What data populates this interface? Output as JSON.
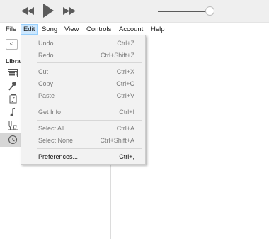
{
  "menubar": {
    "file": "File",
    "edit": "Edit",
    "song": "Song",
    "view": "View",
    "controls": "Controls",
    "account": "Account",
    "help": "Help"
  },
  "sidebar": {
    "back_glyph": "<",
    "library_header": "Libra",
    "icons": [
      "recently-added-icon",
      "artists-icon",
      "albums-icon",
      "songs-icon",
      "genres-icon",
      "downloaded-icon"
    ]
  },
  "player": {
    "icons": [
      "previous-icon",
      "play-icon",
      "next-icon"
    ],
    "volume_level": 0.92
  },
  "edit_menu": {
    "items": [
      {
        "label": "Undo",
        "shortcut": "Ctrl+Z",
        "enabled": false
      },
      {
        "label": "Redo",
        "shortcut": "Ctrl+Shift+Z",
        "enabled": false
      },
      {
        "label": "Cut",
        "shortcut": "Ctrl+X",
        "enabled": false
      },
      {
        "label": "Copy",
        "shortcut": "Ctrl+C",
        "enabled": false
      },
      {
        "label": "Paste",
        "shortcut": "Ctrl+V",
        "enabled": false
      },
      {
        "label": "Get Info",
        "shortcut": "Ctrl+I",
        "enabled": false
      },
      {
        "label": "Select All",
        "shortcut": "Ctrl+A",
        "enabled": false
      },
      {
        "label": "Select None",
        "shortcut": "Ctrl+Shift+A",
        "enabled": false
      },
      {
        "label": "Preferences...",
        "shortcut": "Ctrl+,",
        "enabled": true
      }
    ]
  },
  "colors": {
    "menu_highlight": "#cde8ff",
    "menu_highlight_border": "#99d1ff",
    "disabled_text": "#7a7a7a",
    "selected_row": "#d6d6d6"
  }
}
